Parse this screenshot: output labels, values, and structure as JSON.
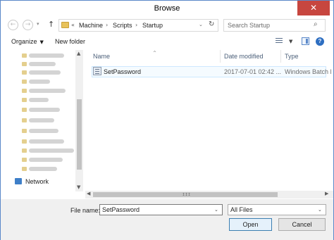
{
  "window": {
    "title": "Browse",
    "close_glyph": "✕"
  },
  "nav": {
    "back_glyph": "←",
    "forward_glyph": "→",
    "dropdown_glyph": "▾",
    "up_glyph": "↑"
  },
  "address": {
    "overflow": "«",
    "segments": [
      "Machine",
      "Scripts",
      "Startup"
    ],
    "separator": "›",
    "dropdown_glyph": "⌄",
    "refresh_glyph": "↻"
  },
  "search": {
    "placeholder": "Search Startup",
    "icon_glyph": "⌕"
  },
  "toolbar": {
    "organize_label": "Organize",
    "caret": "▼",
    "new_folder_label": "New folder",
    "view_dd_glyph": "▼",
    "help_glyph": "?"
  },
  "nav_pane": {
    "network_label": "Network"
  },
  "columns": {
    "name": "Name",
    "date": "Date modified",
    "type": "Type",
    "sort_glyph": "^"
  },
  "files": [
    {
      "name": "SetPassword",
      "date": "2017-07-01 02:42 ...",
      "type": "Windows Batch File"
    }
  ],
  "scroll": {
    "left_glyph": "◀",
    "right_glyph": "▶",
    "up_glyph": "▲",
    "down_glyph": "▼",
    "grip": "III"
  },
  "filename": {
    "label": "File name:",
    "value": "SetPassword",
    "dd_glyph": "⌄"
  },
  "filter": {
    "value": "All Files",
    "dd_glyph": "⌄"
  },
  "buttons": {
    "open": "Open",
    "cancel": "Cancel"
  }
}
